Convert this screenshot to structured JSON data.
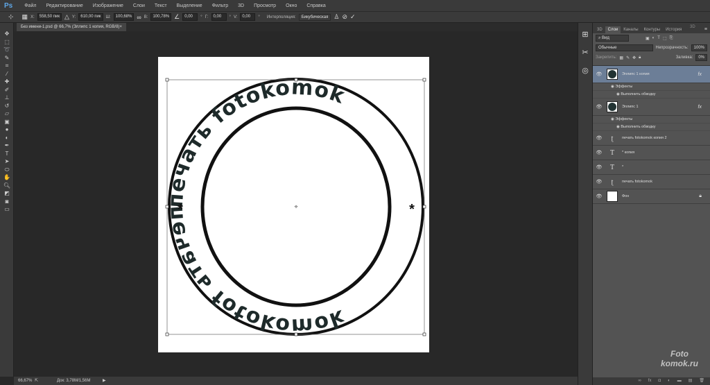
{
  "app": {
    "logo": "Ps"
  },
  "menu": [
    "Файл",
    "Редактирование",
    "Изображение",
    "Слои",
    "Текст",
    "Выделение",
    "Фильтр",
    "3D",
    "Просмотр",
    "Окно",
    "Справка"
  ],
  "options": {
    "x_label": "X:",
    "x": "558,50 пик",
    "y_label": "Y:",
    "y": "610,00 пик",
    "w_label": "Ш:",
    "w": "100,68%",
    "h_label": "В:",
    "h": "100,78%",
    "angle": "0,00",
    "deg": "°",
    "hskew_label": "Г:",
    "hskew": "0,00",
    "vskew_label": "V:",
    "vskew": "0,00",
    "interp_label": "Интерполяция:",
    "interp": "Бикубическая"
  },
  "document": {
    "tab_title": "Без имени-1.psd @ 66,7% (Эллипс 1 копия, RGB/8)",
    "close": "×",
    "ring_text": "печать fotokomok",
    "star": "*"
  },
  "status": {
    "zoom": "66,67%",
    "doc_size": "Док: 3,78M/1,56M"
  },
  "panel": {
    "tabs": [
      "3D",
      "Слои",
      "Каналы",
      "Контуры",
      "История"
    ],
    "filter_placeholder": "Вид",
    "blend_mode": "Обычные",
    "opacity_label": "Непрозрачность:",
    "opacity": "100%",
    "lock_label": "Закрепить:",
    "fill_label": "Заливка:",
    "fill": "0%",
    "layers": [
      {
        "name": "Эллипс 1 копия",
        "type": "shape",
        "fx": "fx",
        "effects": "Эффекты",
        "stroke": "Выполнить обводку",
        "active": true
      },
      {
        "name": "Эллипс 1",
        "type": "shape",
        "fx": "fx",
        "effects": "Эффекты",
        "stroke": "Выполнить обводку"
      },
      {
        "name": "печать fotokomok копия 2",
        "type": "warp-text"
      },
      {
        "name": "* копия",
        "type": "text"
      },
      {
        "name": "*",
        "type": "text"
      },
      {
        "name": "печать fotokomok",
        "type": "warp-text"
      },
      {
        "name": "Фон",
        "type": "background"
      }
    ],
    "right_label": "3D"
  },
  "watermark": {
    "line1": "Foto",
    "line2": "komok.ru"
  },
  "colors": {
    "accent": "#5fa8e8",
    "active_layer": "#6c7e97"
  }
}
